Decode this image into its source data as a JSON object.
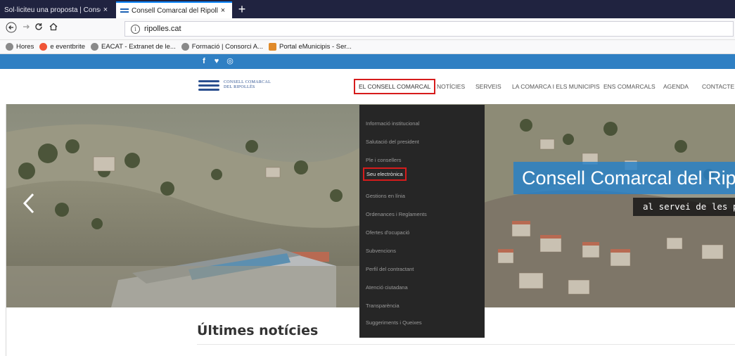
{
  "browser": {
    "tabs": [
      {
        "label": "Sol·liciteu una proposta | Consorci ",
        "close": "×"
      },
      {
        "label": "Consell Comarcal del Ripollès",
        "close": "×"
      }
    ],
    "new_tab": "+",
    "url": "ripolles.cat",
    "bookmarks": [
      {
        "label": "Hores",
        "icon": "globe-icon",
        "color": "#8a8a8a"
      },
      {
        "label": "e eventbrite",
        "icon": "eventbrite-icon",
        "color": "#f05537"
      },
      {
        "label": "EACAT - Extranet de le...",
        "icon": "globe-icon",
        "color": "#8a8a8a"
      },
      {
        "label": "Formació | Consorci A...",
        "icon": "globe-icon",
        "color": "#8a8a8a"
      },
      {
        "label": "Portal eMunicipis - Ser...",
        "icon": "portal-icon",
        "color": "#e08a2a"
      }
    ]
  },
  "site": {
    "social": [
      "f",
      "♥",
      "◎"
    ],
    "logo": {
      "line1": "CONSELL COMARCAL",
      "line2": "DEL RIPOLLÈS"
    },
    "menu": [
      {
        "label": "EL CONSELL COMARCAL",
        "active": true
      },
      {
        "label": "NOTÍCIES"
      },
      {
        "label": "SERVEIS"
      },
      {
        "label": "LA COMARCA I ELS MUNICIPIS"
      },
      {
        "label": "ENS COMARCALS"
      },
      {
        "label": "AGENDA"
      },
      {
        "label": "CONTACTE"
      }
    ],
    "dropdown": [
      "Informació institucional",
      "Salutació del president",
      "Ple i consellers",
      "Seu electrònica",
      "Gestions en línia",
      "Ordenances i Reglaments",
      "Ofertes d'ocupació",
      "Subvencions",
      "Perfil del contractant",
      "Atenció ciutadana",
      "Transparència",
      "Suggeriments i Queixes"
    ],
    "highlighted_dropdown_index": 3,
    "hero": {
      "title": "Consell Comarcal del Ripo",
      "subtitle": "al servei de les per"
    },
    "news_heading": "Últimes notícies"
  },
  "colors": {
    "accent": "#2f7fc3",
    "highlight": "#d61c1c",
    "dropdown_bg": "#262626",
    "tabbar": "#202340"
  }
}
